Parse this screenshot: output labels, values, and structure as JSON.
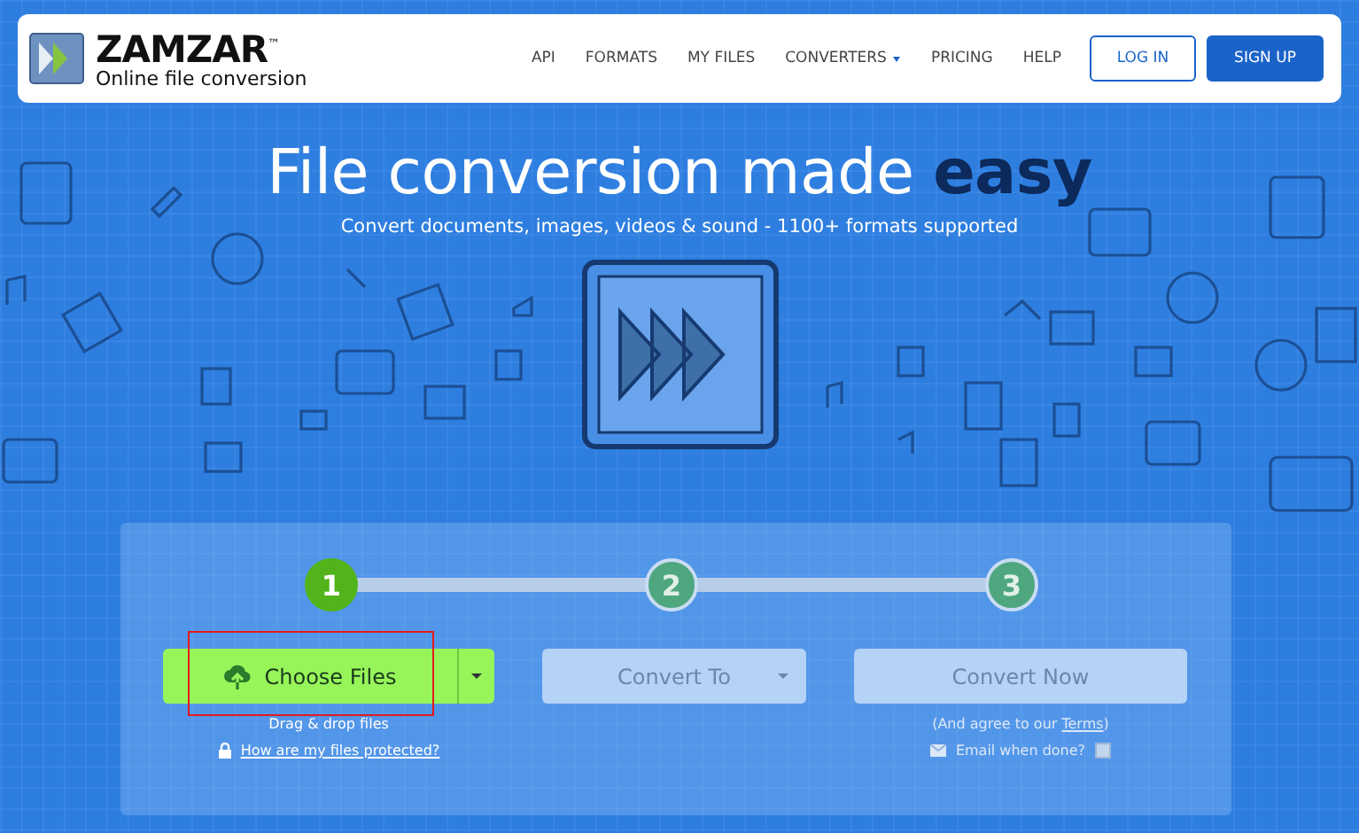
{
  "logo": {
    "name": "ZAMZAR$^{™}$",
    "tagline": "Online file conversion"
  },
  "nav": {
    "links": [
      {
        "label": "API",
        "dropdown": false
      },
      {
        "label": "FORMATS",
        "dropdown": false
      },
      {
        "label": "MY FILES",
        "dropdown": false
      },
      {
        "label": "CONVERTERS",
        "dropdown": true
      },
      {
        "label": "PRICING",
        "dropdown": false
      },
      {
        "label": "HELP",
        "dropdown": false
      }
    ],
    "login": "LOG IN",
    "signup": "SIGN UP"
  },
  "hero": {
    "title": "File conversion made **easy**",
    "subtitle": "Convert documents, images, videos & sound - 1100+ formats supported"
  },
  "steps": [
    {
      "number": "1",
      "selected": true
    },
    {
      "number": "2",
      "selected": false
    },
    {
      "number": "3",
      "selected": false
    }
  ],
  "choose": {
    "label": "Choose Files",
    "hint": "Drag & drop files",
    "protect_link": "How are my files protected?",
    "highlighted": true
  },
  "convert_to": {
    "label": "Convert To",
    "disabled": true
  },
  "convert_now": {
    "label": "Convert Now",
    "disabled": true,
    "terms": "(And agree to our ",
    "terms_link": "Terms",
    "terms_end": ")",
    "email_label": "Email when done?",
    "email_checked": false
  }
}
